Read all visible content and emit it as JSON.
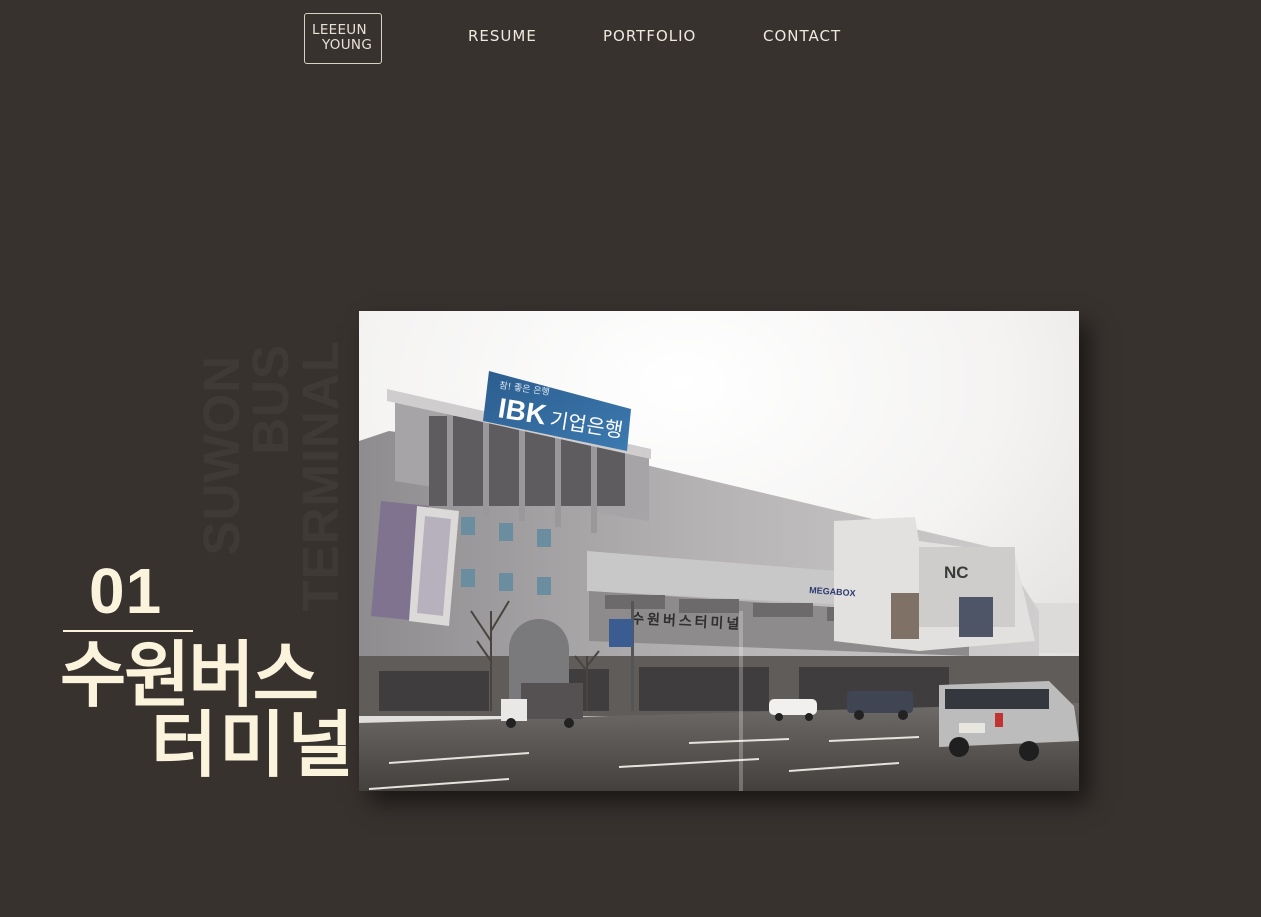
{
  "logo": {
    "line1": "LEEEUN",
    "line2": "YOUNG"
  },
  "nav": {
    "items": [
      {
        "label": "RESUME"
      },
      {
        "label": "PORTFOLIO"
      },
      {
        "label": "CONTACT"
      }
    ]
  },
  "project": {
    "number": "01",
    "title_line1": "수원버스",
    "title_line2": "터미널",
    "watermark": [
      "SUWON",
      "BUS",
      "TERMINAL"
    ]
  },
  "photo": {
    "billboard_brand": "IBK",
    "billboard_korean": "기업은행",
    "billboard_small": "참! 좋은 은행",
    "building_sign": "수원버스터미널",
    "nc_sign": "NC",
    "megabox_sign": "MEGABOX"
  },
  "colors": {
    "background": "#38322f",
    "accent_text": "#fbf3dc",
    "nav_text": "#efe9dd"
  }
}
